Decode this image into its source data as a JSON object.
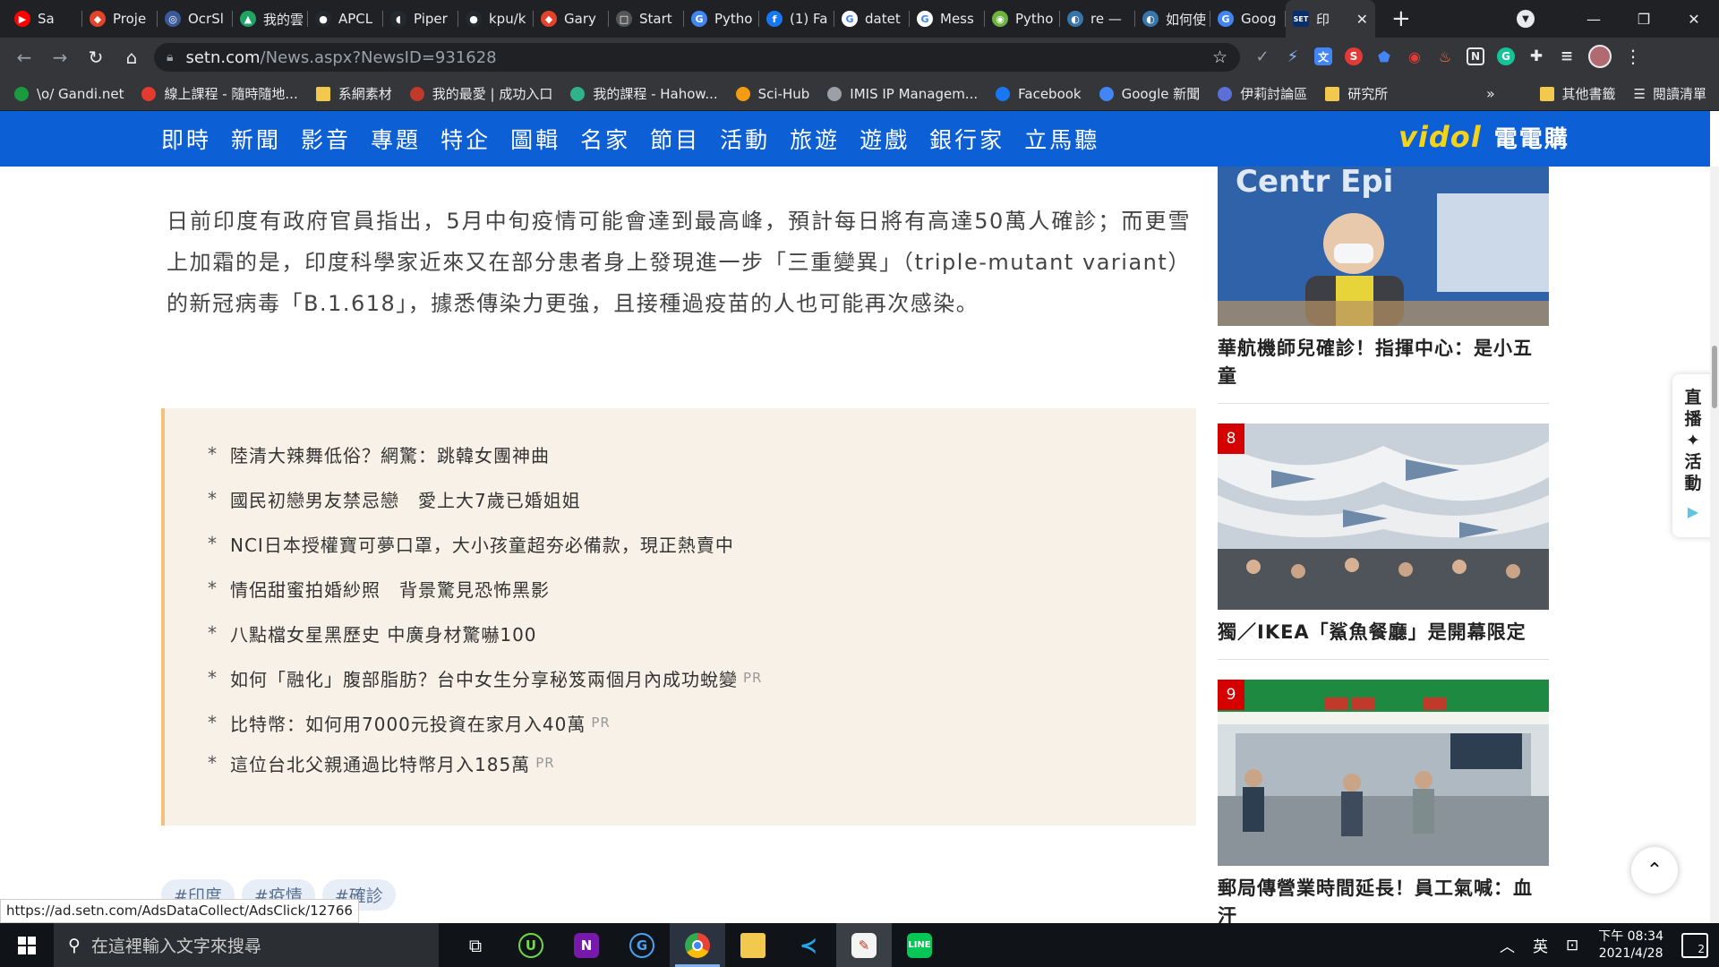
{
  "browser": {
    "tabs": [
      {
        "label": "Sa",
        "color": "#ff0000",
        "glyph": "▶"
      },
      {
        "label": "Proje",
        "color": "#e2432a",
        "glyph": "◆"
      },
      {
        "label": "OcrSl",
        "color": "#3b5998",
        "glyph": "◎"
      },
      {
        "label": "我的雲",
        "color": "#1fa463",
        "glyph": "▲"
      },
      {
        "label": "APCL",
        "color": "#24292e",
        "glyph": "●"
      },
      {
        "label": "Piper",
        "color": "#24292e",
        "glyph": "◖"
      },
      {
        "label": "kpu/k",
        "color": "#24292e",
        "glyph": "●"
      },
      {
        "label": "Gary",
        "color": "#e2432a",
        "glyph": "◆"
      },
      {
        "label": "Start",
        "color": "#555555",
        "glyph": "□"
      },
      {
        "label": "Pytho",
        "color": "#4285f4",
        "glyph": "G"
      },
      {
        "label": "(1) Fa",
        "color": "#1877f2",
        "glyph": "f"
      },
      {
        "label": "datet",
        "color": "#ffffff",
        "glyph": "G"
      },
      {
        "label": "Mess",
        "color": "#ffffff",
        "glyph": "G"
      },
      {
        "label": "Pytho",
        "color": "#6cb33f",
        "glyph": "◉"
      },
      {
        "label": "re —",
        "color": "#3776ab",
        "glyph": "◐"
      },
      {
        "label": "如何使",
        "color": "#3776ab",
        "glyph": "◐"
      },
      {
        "label": "Goog",
        "color": "#4285f4",
        "glyph": "G"
      }
    ],
    "active_tab": {
      "label": "印",
      "badge": "SET"
    },
    "url_host": "setn.com",
    "url_path": "/News.aspx?NewsID=931628",
    "bookmarks": [
      {
        "label": "\\o/ Gandi.net",
        "color": "#1a9c3e"
      },
      {
        "label": "線上課程 - 隨時隨地...",
        "color": "#e33b2e"
      },
      {
        "label": "系網素材",
        "color": "folder"
      },
      {
        "label": "我的最愛 | 成功入口",
        "color": "#c0392b"
      },
      {
        "label": "我的課程 - Hahow...",
        "color": "#2fb38a"
      },
      {
        "label": "Sci-Hub",
        "color": "#f39c12"
      },
      {
        "label": "IMIS IP Managem...",
        "color": "#9aa0a6"
      },
      {
        "label": "Facebook",
        "color": "#1877f2"
      },
      {
        "label": "Google 新聞",
        "color": "#4285f4"
      },
      {
        "label": "伊莉討論區",
        "color": "#5b6fd6"
      },
      {
        "label": "研究所",
        "color": "folder"
      }
    ],
    "bookmarks_more": "»",
    "other_bookmarks": "其他書籤",
    "reading_list": "閱讀清單"
  },
  "site": {
    "nav": [
      "即時",
      "新聞",
      "影音",
      "專題",
      "特企",
      "圖輯",
      "名家",
      "節目",
      "活動",
      "旅遊",
      "遊戲",
      "銀行家",
      "立馬聽"
    ],
    "brand_vidol": "vidol",
    "brand_ebuy": "電電購"
  },
  "article": {
    "paragraph": "日前印度有政府官員指出，5月中旬疫情可能會達到最高峰，預計每日將有高達50萬人確診；而更雪上加霜的是，印度科學家近來又在部分患者身上發現進一步「三重變異」（triple-mutant variant）的新冠病毒「B.1.618」，據悉傳染力更強，且接種過疫苗的人也可能再次感染。"
  },
  "related": [
    {
      "text": "陸清大辣舞低俗？網驚：跳韓女團神曲",
      "pr": ""
    },
    {
      "text": "國民初戀男友禁忌戀　愛上大7歲已婚姐姐",
      "pr": ""
    },
    {
      "text": "NCI日本授權寶可夢口罩，大小孩童超夯必備款，現正熱賣中",
      "pr": ""
    },
    {
      "text": "情侶甜蜜拍婚紗照　背景驚見恐怖黑影",
      "pr": ""
    },
    {
      "text": "八點檔女星黑歷史 中廣身材驚嚇100",
      "pr": ""
    },
    {
      "text": "如何「融化」腹部脂肪？台中女生分享秘笈兩個月內成功蛻變",
      "pr": "PR"
    },
    {
      "text": "比特幣：如何用7000元投資在家月入40萬",
      "pr": "PR"
    },
    {
      "text": "這位台北父親通過比特幣月入185萬 ",
      "pr": "PR"
    }
  ],
  "tags": [
    "#印度",
    "#疫情",
    "#確診"
  ],
  "sidebar": [
    {
      "rank": "",
      "title": "華航機師兒確診！指揮中心：是小五童"
    },
    {
      "rank": "8",
      "title": "獨／IKEA「鯊魚餐廳」是開幕限定"
    },
    {
      "rank": "9",
      "title": "郵局傳營業時間延長！員工氣喊：血汗"
    }
  ],
  "widget": {
    "chars": [
      "直",
      "播",
      "✦",
      "活",
      "動"
    ]
  },
  "status_url": "https://ad.setn.com/AdsDataCollect/AdsClick/12766",
  "taskbar": {
    "search_placeholder": "在這裡輸入文字來搜尋",
    "ime": "英",
    "time": "下午 08:34",
    "date": "2021/4/28",
    "notifications": "2"
  }
}
